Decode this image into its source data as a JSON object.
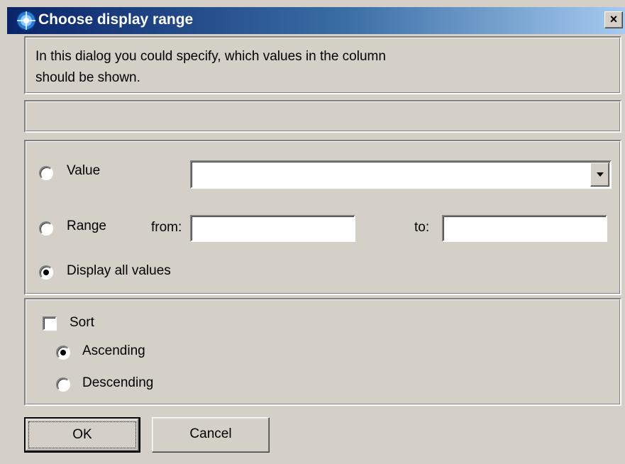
{
  "window": {
    "title": "Choose display range",
    "close_label": "×",
    "icon": "app-globe-icon"
  },
  "intro": {
    "text_line1": "In this dialog you could specify, which values in the column",
    "text_line2": "should be shown."
  },
  "status": {
    "text": ""
  },
  "options": {
    "value_label": "Value",
    "value_selected": "",
    "range_label": "Range",
    "from_label": "from:",
    "from_value": "",
    "to_label": "to:",
    "to_value": "",
    "all_label": "Display all values",
    "selected": "all"
  },
  "sort": {
    "sort_label": "Sort",
    "sort_checked": false,
    "ascending_label": "Ascending",
    "descending_label": "Descending",
    "order_selected": "ascending"
  },
  "buttons": {
    "ok_label": "OK",
    "cancel_label": "Cancel"
  },
  "colors": {
    "face": "#d4d0c8",
    "title_start": "#0a246a",
    "title_end": "#a6caf0"
  }
}
